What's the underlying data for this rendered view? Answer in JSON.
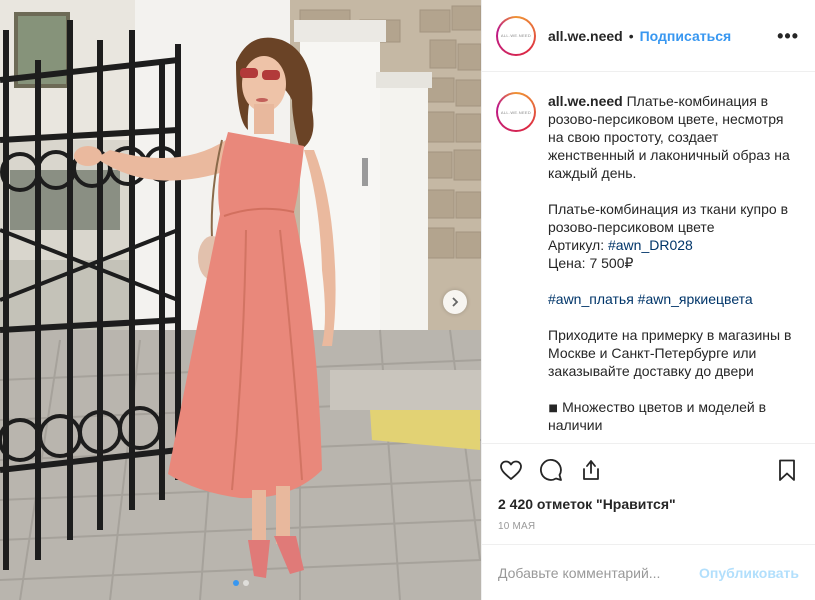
{
  "header": {
    "username": "all.we.need",
    "separator": "•",
    "follow_label": "Подписаться",
    "more_label": "•••",
    "avatar_text": "ALL.WE.NEED"
  },
  "caption": {
    "username": "all.we.need",
    "p1": "Платье-комбинация в розово-персиковом цвете, несмотря на свою простоту, создает женственный и лаконичный образ на каждый день.",
    "p2_line1": "Платье-комбинация из ткани купро в розово-персиковом цвете",
    "article_label": "Артикул: ",
    "article_tag": "#awn_DR028",
    "price": "Цена: 7 500₽",
    "tag1": "#awn_платья",
    "tag2": "#awn_яркиецвета",
    "p4": "Приходите на примерку в магазины в Москве и Санкт-Петербурге или заказывайте доставку до двери",
    "p5": "◾ Множество цветов и моделей в наличии"
  },
  "actions": {
    "like_icon": "heart-icon",
    "comment_icon": "comment-icon",
    "share_icon": "share-icon",
    "save_icon": "bookmark-icon"
  },
  "likes_text": "2 420 отметок \"Нравится\"",
  "date_text": "10 мая",
  "comment": {
    "placeholder": "Добавьте комментарий...",
    "publish_label": "Опубликовать"
  },
  "colors": {
    "accent": "#3897f0",
    "publish_disabled": "#b2dffc",
    "dress": "#e9887b"
  }
}
